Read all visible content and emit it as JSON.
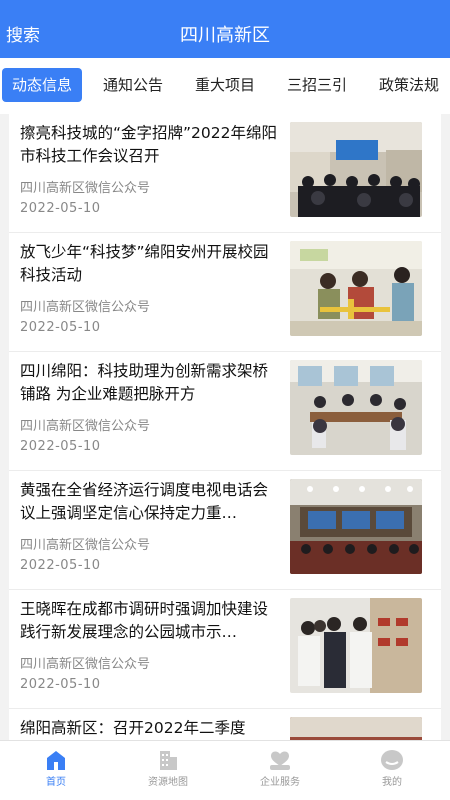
{
  "header": {
    "search_label": "搜索",
    "title": "四川高新区"
  },
  "tabs": [
    {
      "label": "动态信息",
      "active": true
    },
    {
      "label": "通知公告",
      "active": false
    },
    {
      "label": "重大项目",
      "active": false
    },
    {
      "label": "三招三引",
      "active": false
    },
    {
      "label": "政策法规",
      "active": false
    }
  ],
  "news": [
    {
      "title": "擦亮科技城的“金字招牌”2022年绵阳市科技工作会议召开",
      "source": "四川高新区微信公众号",
      "date": "2022-05-10",
      "image": "conference-hall-photo"
    },
    {
      "title": "放飞少年“科技梦”绵阳安州开展校园科技活动",
      "source": "四川高新区微信公众号",
      "date": "2022-05-10",
      "image": "students-model-plane-photo"
    },
    {
      "title": "四川绵阳：科技助理为创新需求架桥铺路 为企业难题把脉开方",
      "source": "四川高新区微信公众号",
      "date": "2022-05-10",
      "image": "office-meeting-photo"
    },
    {
      "title": "黄强在全省经济运行调度电视电话会议上强调坚定信心保持定力重…",
      "source": "四川高新区微信公众号",
      "date": "2022-05-10",
      "image": "video-conference-photo"
    },
    {
      "title": "王晓晖在成都市调研时强调加快建设践行新发展理念的公园城市示…",
      "source": "四川高新区微信公众号",
      "date": "2022-05-10",
      "image": "inspection-visit-photo"
    },
    {
      "title": "绵阳高新区：召开2022年二季度",
      "source": "",
      "date": "",
      "image": "meeting-photo"
    }
  ],
  "bottom_nav": [
    {
      "label": "首页",
      "icon": "home-icon",
      "active": true
    },
    {
      "label": "资源地图",
      "icon": "building-icon",
      "active": false
    },
    {
      "label": "企业服务",
      "icon": "service-icon",
      "active": false
    },
    {
      "label": "我的",
      "icon": "profile-icon",
      "active": false
    }
  ],
  "colors": {
    "accent": "#3a7ff5",
    "inactive": "#c8c8c8"
  }
}
